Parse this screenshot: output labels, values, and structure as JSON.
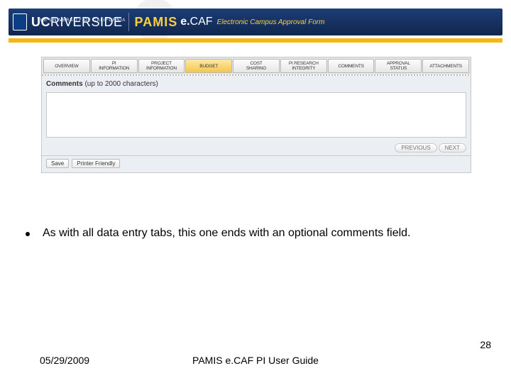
{
  "header": {
    "univ_top": "THE UNIVERSITY OF CALIFORNIA",
    "uc": "UC",
    "riverside": "RIVERSIDE",
    "pamis": "PAMIS",
    "ecaf_e": "e.",
    "ecaf_caf": "CAF",
    "subtitle": "Electronic Campus Approval Form",
    "watermark": "UCR"
  },
  "screenshot": {
    "tabs": [
      "OVERVIEW",
      "PI\nINFORMATION",
      "PROJECT\nINFORMATION",
      "BUDGET",
      "COST\nSHARING",
      "PI RESEARCH\nINTEGRITY",
      "COMMENTS",
      "APPROVAL\nSTATUS",
      "ATTACHMENTS"
    ],
    "active_tab_index": 3,
    "section_label": "Comments",
    "section_hint": "(up to 2000 characters)",
    "textarea_value": "",
    "nav_prev": "PREVIOUS",
    "nav_next": "NEXT",
    "buttons": {
      "save": "Save",
      "print": "Printer Friendly"
    }
  },
  "bullet_text": "As with all data entry tabs, this one ends with an optional comments field.",
  "footer": {
    "date": "05/29/2009",
    "title": "PAMIS e.CAF PI User Guide",
    "page": "28"
  }
}
